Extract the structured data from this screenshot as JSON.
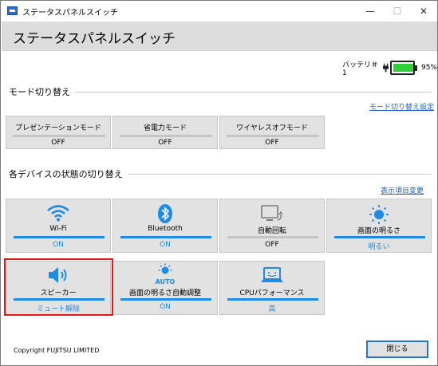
{
  "window": {
    "title": "ステータスパネルスイッチ",
    "controls": {
      "minimize": "—",
      "maximize": "☐",
      "close": "✕"
    }
  },
  "header": {
    "title": "ステータスパネルスイッチ"
  },
  "battery": {
    "label": "バッテリ＃1",
    "percent_text": "95%",
    "level": 0.95,
    "fill_color": "#2fd13a"
  },
  "mode_section": {
    "title": "モード切り替え",
    "settings_link": "モード切り替え設定",
    "tiles": [
      {
        "label": "プレゼンテーションモード",
        "status": "OFF"
      },
      {
        "label": "省電力モード",
        "status": "OFF"
      },
      {
        "label": "ワイヤレスオフモード",
        "status": "OFF"
      }
    ]
  },
  "device_section": {
    "title": "各デバイスの状態の切り替え",
    "settings_link": "表示項目変更",
    "tiles": [
      {
        "label": "Wi-Fi",
        "status": "ON",
        "icon": "wifi-icon"
      },
      {
        "label": "Bluetooth",
        "status": "ON",
        "icon": "bluetooth-icon"
      },
      {
        "label": "自動回転",
        "status": "OFF",
        "icon": "rotate-icon"
      },
      {
        "label": "画面の明るさ",
        "status": "明るい",
        "icon": "brightness-icon"
      },
      {
        "label": "スピーカー",
        "status": "ミュート解除",
        "icon": "speaker-icon"
      },
      {
        "label": "画面の明るさ自動調整",
        "status": "ON",
        "icon": "auto-brightness-icon",
        "icon_text": "AUTO"
      },
      {
        "label": "CPUパフォーマンス",
        "status": "高",
        "icon": "cpu-performance-icon"
      }
    ]
  },
  "colors": {
    "accent": "#1e8be6",
    "highlight": "#e01818",
    "link": "#1a5fcf"
  },
  "footer": {
    "copyright": "Copyright FUJITSU LIMITED",
    "close_label": "閉じる"
  }
}
